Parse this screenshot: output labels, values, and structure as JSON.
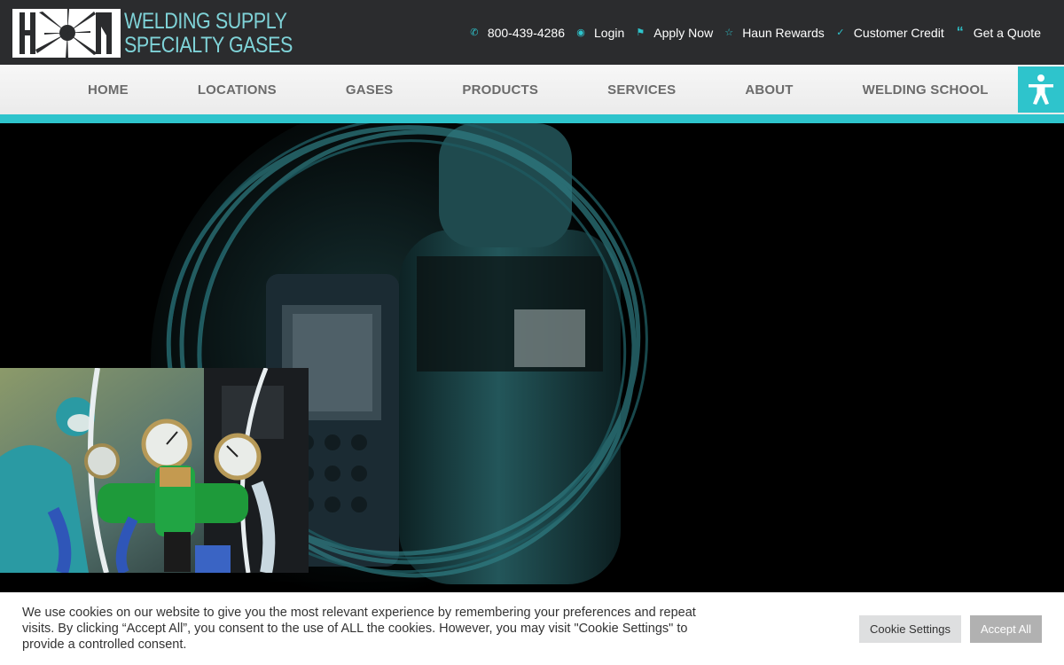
{
  "brand": {
    "logo_line1": "WELDING SUPPLY",
    "logo_line2": "SPECIALTY GASES",
    "accent_color": "#2ec4cc"
  },
  "top_links": [
    {
      "icon": "phone-icon",
      "label": "800-439-4286"
    },
    {
      "icon": "user-circle-icon",
      "label": "Login"
    },
    {
      "icon": "flag-icon",
      "label": "Apply Now"
    },
    {
      "icon": "star-icon",
      "label": "Haun Rewards"
    },
    {
      "icon": "check-icon",
      "label": "Customer Credit"
    },
    {
      "icon": "quote-icon",
      "label": "Get a Quote"
    }
  ],
  "nav": {
    "items": [
      "HOME",
      "LOCATIONS",
      "GASES",
      "PRODUCTS",
      "SERVICES",
      "ABOUT",
      "WELDING SCHOOL"
    ]
  },
  "accessibility": {
    "icon": "accessibility-icon"
  },
  "cookie": {
    "text": "We use cookies on our website to give you the most relevant experience by remembering your preferences and repeat visits. By clicking “Accept All”, you consent to the use of ALL the cookies. However, you may visit \"Cookie Settings\" to provide a controlled consent.",
    "settings_label": "Cookie Settings",
    "accept_label": "Accept All"
  }
}
